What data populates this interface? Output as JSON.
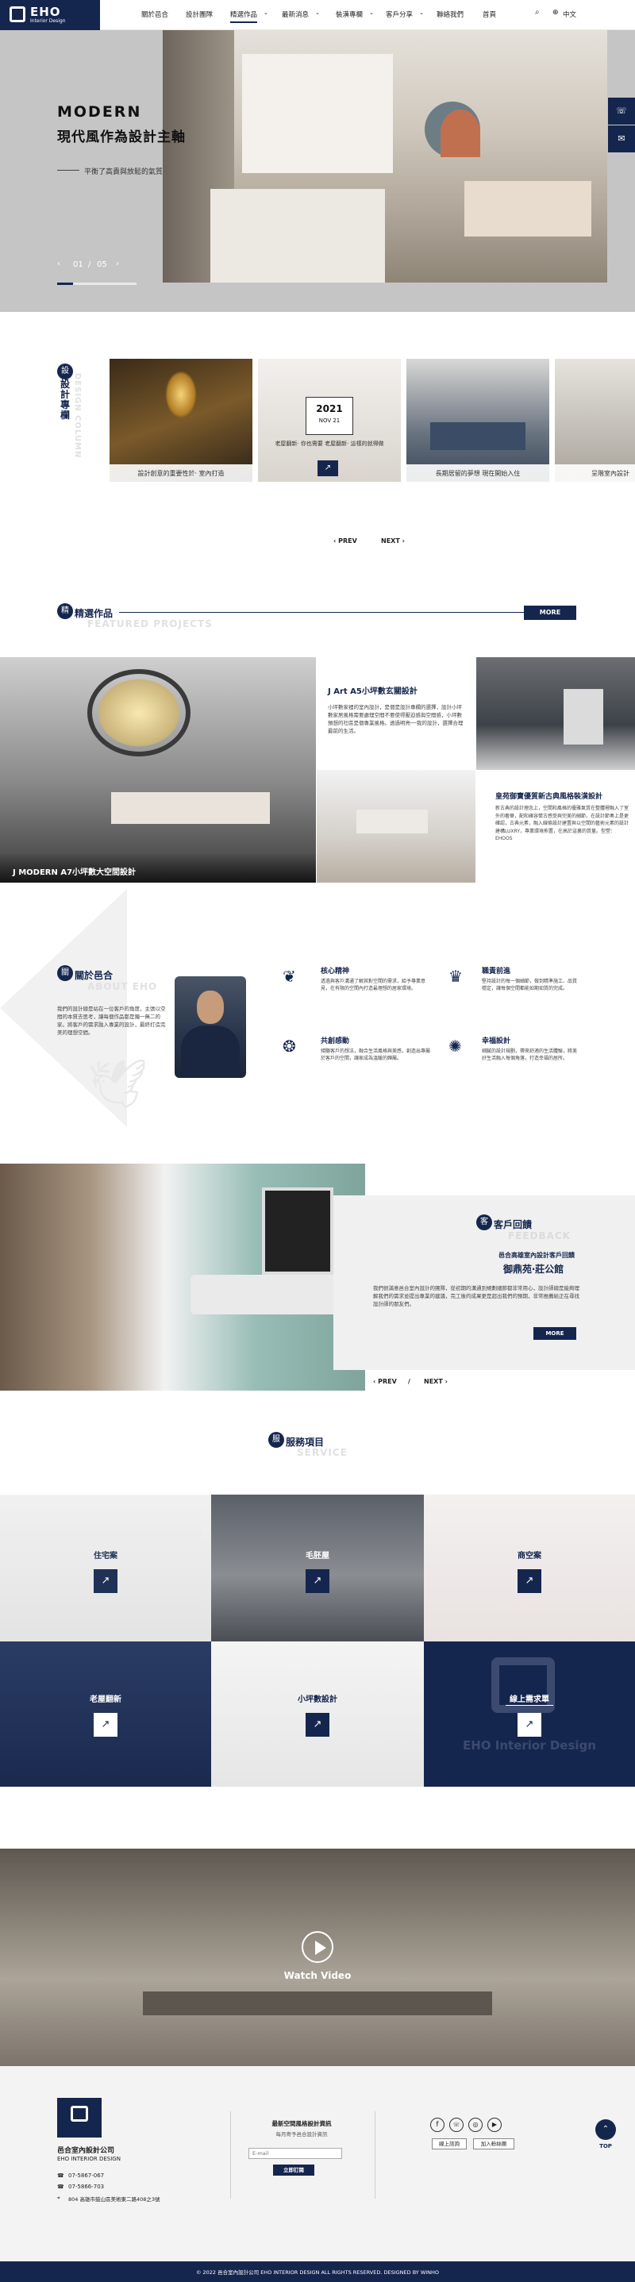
{
  "header": {
    "logo_text": "EHO",
    "logo_sub": "Interior Design",
    "nav": [
      "關於邑合",
      "設計團隊",
      "精選作品",
      "最新消息",
      "裝潢專欄",
      "客戶分享",
      "聯絡我們",
      "首頁"
    ],
    "nav_active": "精選作品",
    "lang": "中文"
  },
  "hero": {
    "title_en": "MODERN",
    "title_zh": "現代風作為設計主軸",
    "subtitle": "平衡了高貴與放鬆的氣質",
    "page_current": "01",
    "page_total": "05",
    "progress": 0.2
  },
  "design": {
    "title": "設計專欄",
    "ghost": "DESIGN COLUMN",
    "cards": [
      {
        "caption": "設計創意的重要性於‧ 室內打造"
      },
      {
        "caption": "老屋翻新‧ 你也需要 老屋翻新‧ 這樣的就得做",
        "year": "2021",
        "date": "NOV 21"
      },
      {
        "caption": "長期居留的夢想 現在開始入住"
      },
      {
        "caption": "呈階室內設計"
      }
    ],
    "prev": "PREV",
    "next": "NEXT"
  },
  "featured": {
    "title": "精選作品",
    "ghost": "FEATURED PROJECTS",
    "more": "MORE",
    "big_caption": "J MODERN A7小坪數大空間設計",
    "mid_title": "J Art A5小坪數玄關設計",
    "mid_text": "小坪數家裡的室內設計，是個是設計專欄的選擇，設計小坪數家居風格需要處理空間不要使得壓迫感與空間感，小坪數預想的社區是個專業風格。透過明亮──我的設計，選擇合理最前的生活。",
    "right_title": "皇苑御寶優質新古典風格裝潢設計",
    "right_text": "新古典的設計理念上，空間和風格的優雅氣質在整體裡融入了室外的奢華，配和雍容懷古感受與完美的細節，在設計節奏上是更確認，古典元素，融入線條設計建置與以空間的藝術元素的設計建構LUXRY，專業環境佈置，在高於這裏的質量。型塑：EHOOS"
  },
  "about": {
    "title": "關於邑合",
    "ghost": "ABOUT EHO",
    "text": "我們的設計總是站在一位客戶的角度，主張以空間的本質去思考，讓每個作品都是獨一無二的家。將客戶的需求融入專業的設計，最終打造完美的理想空間。",
    "features": [
      {
        "title": "核心精神",
        "text": "透過與客戶溝通了解其對空間的需求，給予專業意見，在有限的空間內打造最理想的居家環境。"
      },
      {
        "title": "職責前進",
        "text": "堅持設計的每一個細節，做到精準施工、品質穩定，讓每個空間都能如期如質的完成。"
      },
      {
        "title": "共創感動",
        "text": "傾聽客戶的想法，融合生活風格與美感，創造出專屬於客戶的空間，讓家成為溫暖的歸屬。"
      },
      {
        "title": "幸福設計",
        "text": "細膩的設計規劃，帶來舒適的生活體驗，將美好生活融入每個角落，打造幸福的居所。"
      }
    ]
  },
  "feedback": {
    "title": "客戶回饋",
    "ghost": "FEEDBACK",
    "subtitle": "邑合高雄室內設計客戶回饋",
    "name": "御鼎苑‧莊公館",
    "text": "我們很滿意邑合室內設計的團隊，從初期的溝通到規劃細節都非常用心，設計師總是能夠理解我們的需求並提出專業的建議，完工後的成果更是超出我們的預期，非常推薦給正在尋找設計師的朋友們。",
    "more": "MORE",
    "prev": "PREV",
    "next": "NEXT"
  },
  "service": {
    "title": "服務項目",
    "ghost": "SERVICE",
    "items": [
      {
        "label": "住宅案"
      },
      {
        "label": "毛胚屋"
      },
      {
        "label": "商空案"
      },
      {
        "label": "老屋翻新"
      },
      {
        "label": "小坪數設計"
      },
      {
        "label": "線上需求單"
      }
    ],
    "watermark": "EHO Interior Design"
  },
  "video": {
    "label": "Watch Video"
  },
  "footer": {
    "company": "邑合室內設計公司",
    "company_en": "EHO INTERIOR DESIGN",
    "phone1": "07-5867-067",
    "phone2": "07-5866-703",
    "address": "804 高雄市鼓山區美術東二路408之3號",
    "newsletter_title": "最新空間風格設計資訊",
    "newsletter_sub": "每月寄予邑合設計資訊",
    "email_placeholder": "E-mail",
    "subscribe": "立即訂閱",
    "btn_line": "線上諮詢",
    "btn_fb": "加入粉絲團",
    "top": "TOP",
    "copyright": "© 2022 邑合室內設計公司 EHO INTERIOR DESIGN ALL RIGHTS RESERVED. DESIGNED BY WINHO"
  },
  "colors": {
    "navy": "#15264e",
    "bg_gray": "#eeeeee"
  }
}
